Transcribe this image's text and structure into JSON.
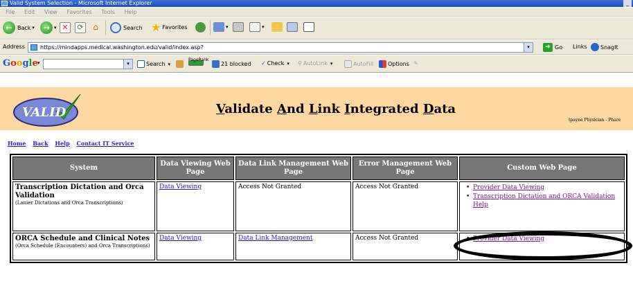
{
  "window": {
    "title": "Valid System Selection - Microsoft Internet Explorer",
    "minimize_label": "_"
  },
  "menu": [
    "File",
    "Edit",
    "View",
    "Favorites",
    "Tools",
    "Help"
  ],
  "toolbar": {
    "back_label": "Back",
    "search_label": "Search",
    "favorites_label": "Favorites"
  },
  "address": {
    "label": "Address",
    "url": "https://mindapps.medical.washington.edu/valid/index.asp?",
    "go_label": "Go",
    "links_label": "Links",
    "snagit_label": "SnagIt"
  },
  "googlebar": {
    "logo": [
      "G",
      "o",
      "o",
      "g",
      "l",
      "e"
    ],
    "search_label": "Search",
    "pagerank_label": "PageRank",
    "blocked_label": "21 blocked",
    "check_label": "Check",
    "autolink_label": "AutoLink",
    "autofill_label": "AutoFill",
    "options_label": "Options"
  },
  "page": {
    "logo_text": "VALID",
    "title_parts": [
      "V",
      "alidate ",
      "A",
      "nd ",
      "L",
      "ink ",
      "I",
      "ntegrated ",
      "D",
      "ata"
    ],
    "user_info": "tpayne Physician - Phare",
    "nav": [
      "Home",
      "Back",
      "Help",
      "Contact IT Service"
    ],
    "table": {
      "headers": [
        "System",
        "Data Viewing Web Page",
        "Data Link Management Web Page",
        "Error Management Web Page",
        "Custom Web Page"
      ],
      "rows": [
        {
          "system": "Transcription Dictation and Orca Validation",
          "system_desc": "(Lanier Dictations and Orca Transcriptions)",
          "data_viewing": "Data Viewing",
          "data_link": "Access Not Granted",
          "error_mgmt": "Access Not Granted",
          "custom": [
            "Provider Data Viewing",
            "Transcription Dictation and ORCA Validation Help"
          ]
        },
        {
          "system": "ORCA Schedule and Clinical Notes",
          "system_desc": "(Orca Schedule (Encounters) and Orca Transcriptions)",
          "data_viewing": "Data Viewing",
          "data_link": "Data Link Management",
          "error_mgmt": "Access Not Granted",
          "custom": [
            "Provider Data Viewing"
          ]
        }
      ]
    }
  },
  "colors": {
    "banner": "#fdd8a0",
    "header_cell": "#777777",
    "link": "#2c18c8",
    "visited_link": "#7a1a8a"
  }
}
